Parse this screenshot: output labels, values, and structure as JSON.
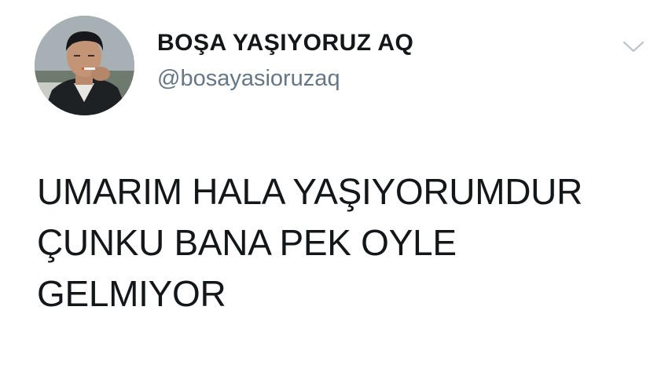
{
  "author": {
    "display_name": "BOŞA YAŞIYORUZ AQ",
    "handle": "@bosayasioruzaq",
    "avatar_icon": "profile-photo"
  },
  "menu": {
    "icon": "chevron-down-icon"
  },
  "tweet": {
    "lines": [
      "UMARIM HALA YAŞIYORUMDUR",
      "ÇUNKU BANA PEK OYLE",
      "GELMIYOR"
    ]
  },
  "colors": {
    "text": "#14171a",
    "handle": "#657786",
    "chevron": "#b8c2c8",
    "background": "#ffffff"
  }
}
